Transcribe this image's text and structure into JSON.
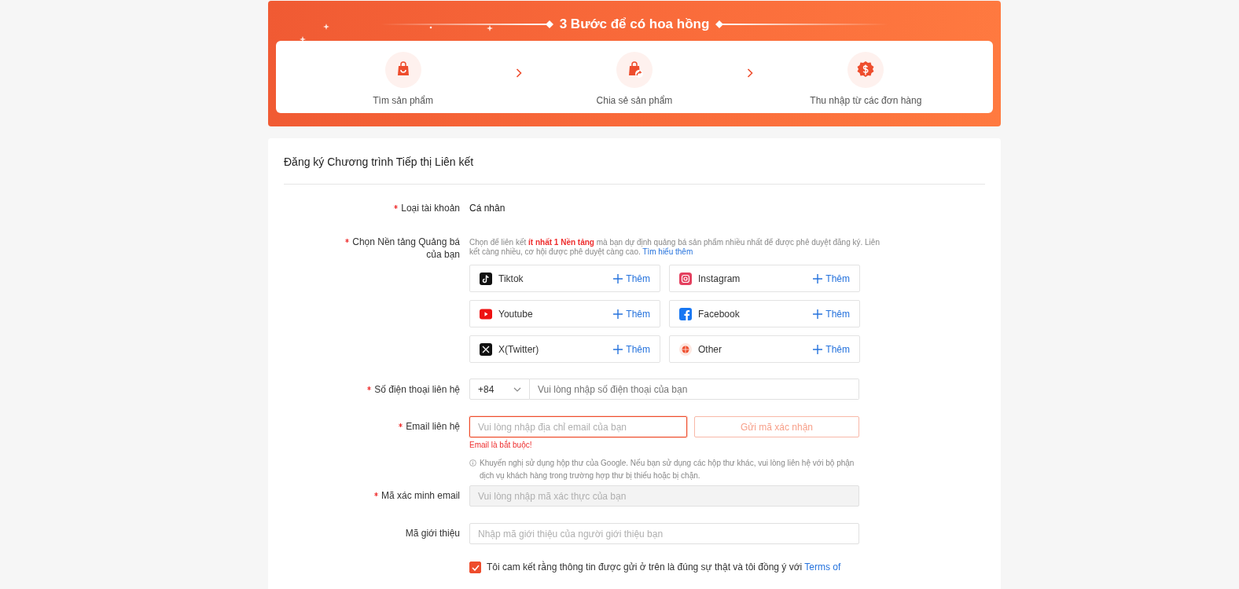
{
  "banner": {
    "title": "3 Bước để có hoa hồng",
    "steps": [
      {
        "kind": "bag",
        "label": "Tìm sản phẩm"
      },
      {
        "kind": "share",
        "label": "Chia sẻ sản phẩm"
      },
      {
        "kind": "money",
        "label": "Thu nhập từ các đơn hàng"
      }
    ]
  },
  "form": {
    "title": "Đăng ký Chương trình Tiếp thị Liên kết",
    "account_type": {
      "label": "Loại tài khoản",
      "required": true,
      "value": "Cá nhân"
    },
    "platforms": {
      "label": "Chọn Nền tảng Quảng bá của bạn",
      "required": true,
      "hint": "Chọn để liên kết **ít nhất 1 Nền tảng** mà bạn dự định quảng bá sản phẩm nhiều nhất để được phê duyệt đăng ký. Liên kết càng nhiều, cơ hội được phê duyệt càng cao.",
      "hint_link": "Tìm hiểu thêm",
      "items": [
        {
          "kind": "tiktok",
          "name": "Tiktok",
          "action": "Thêm"
        },
        {
          "kind": "instagram",
          "name": "Instagram",
          "action": "Thêm"
        },
        {
          "kind": "youtube",
          "name": "Youtube",
          "action": "Thêm"
        },
        {
          "kind": "facebook",
          "name": "Facebook",
          "action": "Thêm"
        },
        {
          "kind": "x",
          "name": "X(Twitter)",
          "action": "Thêm"
        },
        {
          "kind": "other",
          "name": "Other",
          "action": "Thêm"
        }
      ]
    },
    "phone": {
      "label": "Số điện thoại liên hệ",
      "required": true,
      "country_code": "+84",
      "placeholder": "Vui lòng nhập số điện thoại của bạn"
    },
    "email": {
      "label": "Email liên hệ",
      "required": true,
      "placeholder": "Vui lòng nhập địa chỉ email của bạn",
      "error": true,
      "error_message": "Email là bắt buộc!",
      "send_button": {
        "label": "Gửi mã xác nhận",
        "disabled": true
      },
      "note": "Khuyến nghị sử dụng hộp thư của Google. Nếu bạn sử dụng các hộp thư khác, vui lòng liên hệ với bộ phận dịch vụ khách hàng trong trường hợp thư bị thiếu hoặc bị chặn."
    },
    "verification": {
      "label": "Mã xác minh email",
      "required": true,
      "placeholder": "Vui lòng nhập mã xác thực của bạn",
      "disabled": true
    },
    "referral": {
      "label": "Mã giới thiệu",
      "required": false,
      "placeholder": "Nhập mã giới thiệu của người giới thiệu bạn"
    },
    "agreement": {
      "checked": true,
      "text": "Tôi cam kết rằng thông tin được gửi ở trên là đúng sự thật và tôi đồng ý với ",
      "link": "Terms of"
    }
  }
}
